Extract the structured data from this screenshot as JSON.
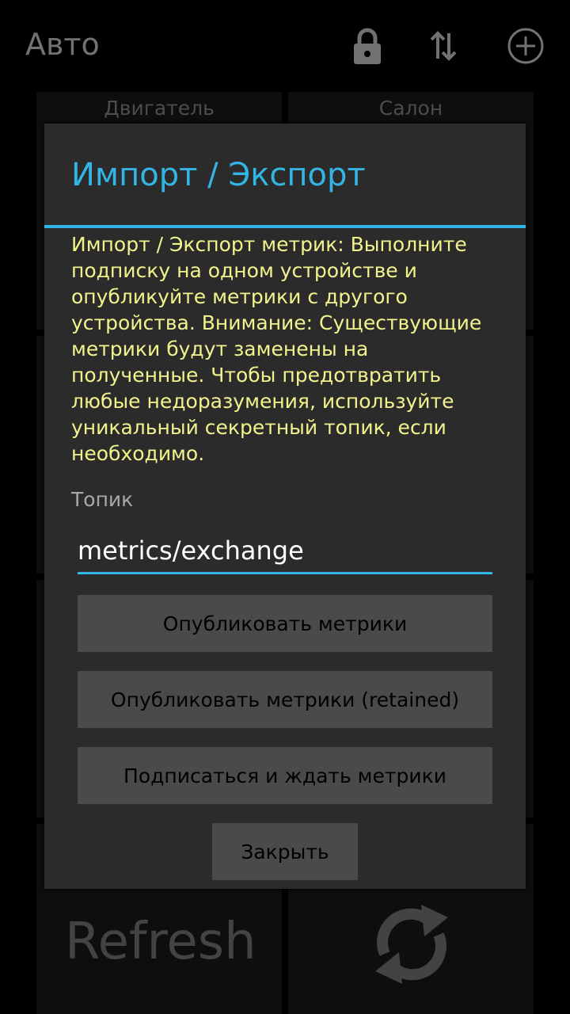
{
  "actionbar": {
    "title": "Авто",
    "icons": [
      "lock-icon",
      "sort-arrows-icon",
      "add-circle-icon"
    ]
  },
  "grid": {
    "tile_engine": "Двигатель",
    "tile_salon": "Салон",
    "tile_refresh": "Refresh",
    "refresh_icon": "refresh-icon"
  },
  "dialog": {
    "title": "Импорт / Экспорт",
    "message": "Импорт / Экспорт метрик: Выполните подписку на одном устройстве и опубликуйте метрики с другого устройства. Внимание: Существующие метрики будут заменены на полученные. Чтобы предотвратить любые недоразумения, используйте уникальный секретный топик, если необходимо.",
    "topic_label": "Топик",
    "topic_value": "metrics/exchange",
    "btn_publish": "Опубликовать метрики",
    "btn_publish_retained": "Опубликовать метрики (retained)",
    "btn_subscribe": "Подписаться и ждать метрики",
    "btn_close": "Закрыть"
  },
  "colors": {
    "accent": "#33b5e5",
    "message_text": "#f3f38e",
    "dialog_bg": "#2b2b2b",
    "button_bg": "#4a4a4a"
  }
}
